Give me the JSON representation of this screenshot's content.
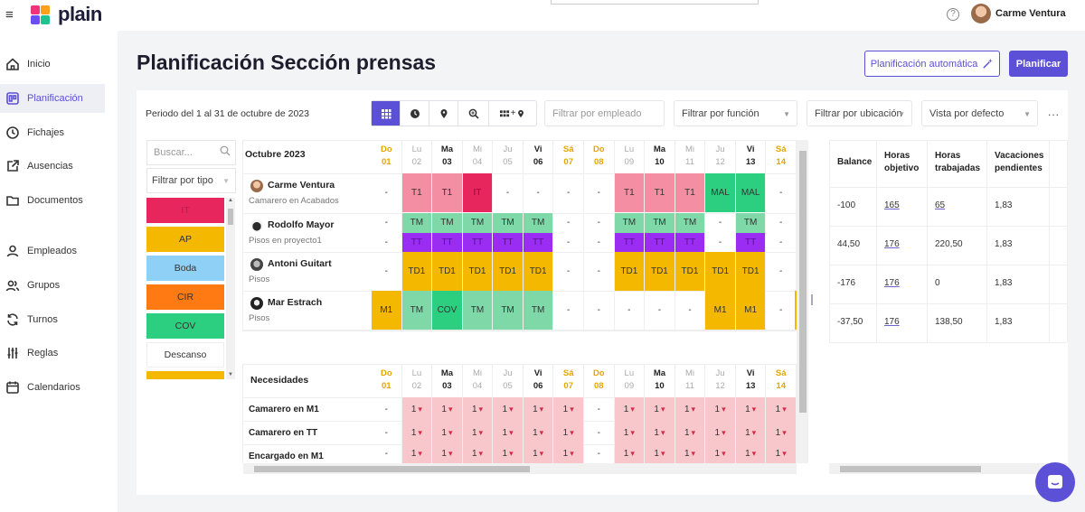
{
  "app": {
    "logo_text": "plain",
    "user_name": "Carme Ventura",
    "help_icon": "?",
    "colors": {
      "accent": "#5b50d6"
    }
  },
  "nav": [
    {
      "label": "Inicio",
      "icon": "home-icon"
    },
    {
      "label": "Planificación",
      "icon": "calendar-board-icon",
      "active": true
    },
    {
      "label": "Fichajes",
      "icon": "clock-icon"
    },
    {
      "label": "Ausencias",
      "icon": "external-link-icon"
    },
    {
      "label": "Documentos",
      "icon": "folder-icon"
    },
    {
      "label": "Empleados",
      "icon": "user-icon"
    },
    {
      "label": "Grupos",
      "icon": "users-icon"
    },
    {
      "label": "Turnos",
      "icon": "refresh-icon"
    },
    {
      "label": "Reglas",
      "icon": "sliders-icon"
    },
    {
      "label": "Calendarios",
      "icon": "calendar-icon"
    }
  ],
  "page": {
    "title": "Planificación Sección prensas",
    "auto_button": "Planificación automática",
    "plan_button": "Planificar",
    "period": "Periodo del 1 al 31 de octubre de 2023",
    "more": "..."
  },
  "toolbar": {
    "view_icons": [
      "grid-view-icon",
      "clock-view-icon",
      "location-view-icon",
      "zoom-view-icon",
      "grid-location-view-icon"
    ],
    "filter_employee_placeholder": "Filtrar por empleado",
    "filter_function": "Filtrar por función",
    "filter_location": "Filtrar por ubicación",
    "view_default": "Vista por defecto"
  },
  "sidebar_panel": {
    "search_placeholder": "Buscar...",
    "type_filter": "Filtrar por tipo",
    "legend": [
      {
        "label": "IT",
        "color": "#e8265e",
        "text_color": "#b81d4b"
      },
      {
        "label": "AP",
        "color": "#f5b800",
        "text_color": "#333"
      },
      {
        "label": "Boda",
        "color": "#8fd0f7",
        "text_color": "#333"
      },
      {
        "label": "CIR",
        "color": "#ff7a12",
        "text_color": "#333"
      },
      {
        "label": "COV",
        "color": "#2ccf7f",
        "text_color": "#333"
      },
      {
        "label": "Descanso",
        "color": "#ffffff",
        "text_color": "#333"
      },
      {
        "label": "",
        "color": "#f5b800",
        "text_color": "#333"
      }
    ]
  },
  "schedule": {
    "month_label": "Octubre 2023",
    "days": [
      {
        "dn": "Do",
        "dd": "01",
        "type": "we"
      },
      {
        "dn": "Lu",
        "dd": "02",
        "type": "light"
      },
      {
        "dn": "Ma",
        "dd": "03",
        "type": "dark"
      },
      {
        "dn": "Mi",
        "dd": "04",
        "type": "light"
      },
      {
        "dn": "Ju",
        "dd": "05",
        "type": "light"
      },
      {
        "dn": "Vi",
        "dd": "06",
        "type": "dark"
      },
      {
        "dn": "Sá",
        "dd": "07",
        "type": "we"
      },
      {
        "dn": "Do",
        "dd": "08",
        "type": "we"
      },
      {
        "dn": "Lu",
        "dd": "09",
        "type": "light"
      },
      {
        "dn": "Ma",
        "dd": "10",
        "type": "dark"
      },
      {
        "dn": "Mi",
        "dd": "11",
        "type": "light"
      },
      {
        "dn": "Ju",
        "dd": "12",
        "type": "light"
      },
      {
        "dn": "Vi",
        "dd": "13",
        "type": "dark"
      },
      {
        "dn": "Sá",
        "dd": "14",
        "type": "we"
      }
    ],
    "employees": [
      {
        "name": "Carme Ventura",
        "role": "Camarero en Acabados",
        "rows": [
          [
            "-",
            "T1",
            "T1",
            "IT",
            "-",
            "-",
            "-",
            "-",
            "T1",
            "T1",
            "T1",
            "MAL",
            "MAL",
            "-"
          ]
        ]
      },
      {
        "name": "Rodolfo Mayor",
        "role": "Pisos en proyecto1",
        "rows": [
          [
            "-",
            "TM",
            "TM",
            "TM",
            "TM",
            "TM",
            "-",
            "-",
            "TM",
            "TM",
            "TM",
            "-",
            "TM",
            "-"
          ],
          [
            "-",
            "TT",
            "TT",
            "TT",
            "TT",
            "TT",
            "-",
            "-",
            "TT",
            "TT",
            "TT",
            "-",
            "TT",
            "-"
          ]
        ]
      },
      {
        "name": "Antoni Guitart",
        "role": "Pisos",
        "rows": [
          [
            "-",
            "TD1",
            "TD1",
            "TD1",
            "TD1",
            "TD1",
            "-",
            "-",
            "TD1",
            "TD1",
            "TD1",
            "TD1",
            "TD1",
            "-"
          ]
        ]
      },
      {
        "name": "Mar Estrach",
        "role": "Pisos",
        "rows": [
          [
            "M1",
            "TM",
            "COV",
            "TM",
            "TM",
            "TM",
            "-",
            "-",
            "-",
            "-",
            "-",
            "M1",
            "M1",
            "-"
          ]
        ]
      }
    ],
    "needs_label": "Necesidades",
    "needs": [
      {
        "label": "Camarero en M1",
        "values": [
          "-",
          "1",
          "1",
          "1",
          "1",
          "1",
          "1",
          "-",
          "1",
          "1",
          "1",
          "1",
          "1",
          "1"
        ]
      },
      {
        "label": "Camarero en TT",
        "values": [
          "-",
          "1",
          "1",
          "1",
          "1",
          "1",
          "1",
          "-",
          "1",
          "1",
          "1",
          "1",
          "1",
          "1"
        ]
      },
      {
        "label": "Encargado en M1",
        "values": [
          "-",
          "1",
          "1",
          "1",
          "1",
          "1",
          "1",
          "-",
          "1",
          "1",
          "1",
          "1",
          "1",
          "1"
        ]
      }
    ],
    "shift_colors": {
      "T1": "#f48ea3",
      "IT": "#e8265e",
      "MAL": "#2ccf7f",
      "TM": "#7fd8a8",
      "TT": "#9b2cf2",
      "TD1": "#f5b800",
      "M1": "#f5b800",
      "COV": "#2ccf7f"
    }
  },
  "totals": {
    "headers": [
      "Balance",
      "Horas objetivo",
      "Horas trabajadas",
      "Vacaciones pendientes"
    ],
    "rows": [
      [
        "-100",
        "165",
        "65",
        "1,83"
      ],
      [
        "44,50",
        "176",
        "220,50",
        "1,83"
      ],
      [
        "-176",
        "176",
        "0",
        "1,83"
      ],
      [
        "-37,50",
        "176",
        "138,50",
        "1,83"
      ]
    ]
  }
}
